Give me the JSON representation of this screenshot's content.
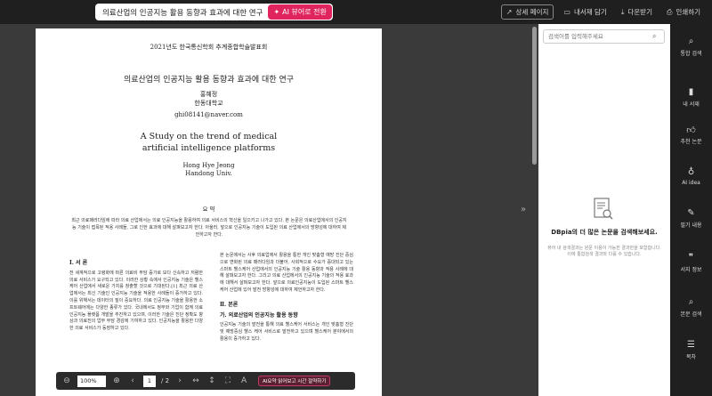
{
  "topbar": {
    "doc_title": "의료산업의 인공지능 활용 동향과 효과에 대한 연구",
    "ai_button": "AI 뷰어로 전환",
    "actions": [
      {
        "label": "상세 페이지",
        "icon": "external-link-icon"
      },
      {
        "label": "내서재 담기",
        "icon": "bookmark-icon"
      },
      {
        "label": "다운받기",
        "icon": "download-icon"
      },
      {
        "label": "인쇄하기",
        "icon": "print-icon"
      }
    ]
  },
  "document": {
    "conference": "2021년도 한국통신학회 추계종합학술발표회",
    "title_ko": "의료산업의 인공지능 활용 동향과 효과에 대한 연구",
    "author_ko": "홍혜정",
    "affiliation_ko": "한동대학교",
    "email": "ghi08141@naver.com",
    "title_en_line1": "A Study on the trend of medical",
    "title_en_line2": "artificial intelligence platforms",
    "author_en": "Hong Hye Jeong",
    "affiliation_en": "Handong Univ.",
    "abstract_heading": "요 약",
    "abstract_text": "최근 의료패러다임에 따라 의료 산업에서는 의료 인공지능을 활용하여 의료 서비스의 혁신을 일으키고 나가고 있다. 본 논문은 의료산업에서의 인공지능 기술이 접목된 적용 사례들, 그로 인한 효과에 대해 살펴보고자 한다. 아울러, 앞으로 인공지능 기술이 도입된 의료 산업에서의 방향성에 대하여 제언하고자 한다.",
    "section1_heading": "Ⅰ. 서 론",
    "section1_text": "전 세계적으로 고령화에 따른 의료비 부담 증가로 보다 신속하고 저렴한 의료 서비스가 요구되고 있다. 이러한 상황 속에서 인공지능 기술은 헬스케어 산업에서 새로운 가치를 창출할 것으로 기대된다.[1] 최근 의료 산업에서는 최신 기술인 인공지능 기술을 적용한 사례들이 증가하고 있다. 이를 위해서는 데이터의 질이 중요하다. 의료 인공지능 기술을 활용한 소프트웨어에는 다양한 종류가 있다. 국내에서도 정부와 기업이 함께 의료 인공지능 플랫폼 개발을 추진하고 있으며, 이러한 기술은 진단 정확도 향상과 의료진의 업무 부담 경감에 기여하고 있다. 인공지능을 활용한 다양한 의료 서비스가 등장하고 있다.",
    "col2_text": "본 논문에서는 사후 의료업에서 활용을 통한 개인 맞춤형 예방 진단 중심으로 변화된 의료 패러다임과 더불어, 사회적으로 수요가 증대되고 있는 스마트 헬스케어 산업에서의 인공지능 기술 활용 동향과 적용 사례에 대해 살펴보고자 한다. 그리고 의료 산업에서의 인공지능 기술의 적용 효과에 대해서 살펴보고자 한다. 앞으로 의료인공지능이 도입된 스마트 헬스케어 산업에 있어 발전 방향성에 대하여 제언하고자 한다.",
    "section2_heading": "Ⅱ. 본론",
    "section2a_heading": "가. 의료산업의 인공지능 활용 동향",
    "section2a_text": "인공지능 기술의 발전을 통해 의료 헬스케어 서비스는 개인 맞춤형 진단 및 예방중심 헬스 케어 서비스로 발전하고 있으며 헬스케어 분야에서의 활용이 증가하고 있다."
  },
  "viewer_toolbar": {
    "zoom": "100%",
    "current_page": "1",
    "total_pages": "/ 2",
    "ai_summary": "AI요약 읽어보고 시간 절약하기"
  },
  "search_panel": {
    "placeholder": "검색어를 입력해주세요",
    "empty_title": "DBpia의 더 많은 논문을 검색해보세요.",
    "empty_desc": "뷰어 내 검색결과는 원문 이용이 가능한 결과만을 포함합니다. 이에 통합검색 결과와 다를 수 있습니다."
  },
  "right_nav": [
    {
      "label": "통합 검색",
      "icon": "search-icon"
    },
    {
      "label": "내 서재",
      "icon": "library-icon"
    },
    {
      "label": "추천 논문",
      "icon": "thumbs-up-icon"
    },
    {
      "label": "AI idea",
      "icon": "lightbulb-icon"
    },
    {
      "label": "필기 내용",
      "icon": "note-icon"
    },
    {
      "label": "서지 정보",
      "icon": "quote-icon"
    },
    {
      "label": "본문 검색",
      "icon": "text-search-icon"
    },
    {
      "label": "목차",
      "icon": "list-icon"
    }
  ]
}
